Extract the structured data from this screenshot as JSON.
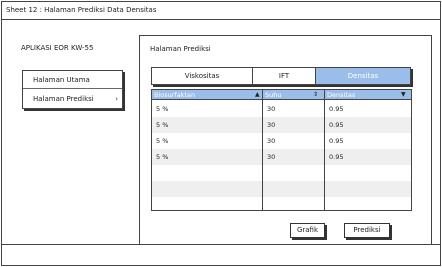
{
  "window": {
    "title": "Sheet 12 : Halaman Prediksi Data Densitas"
  },
  "app": {
    "title": "APLIKASI EOR KW-55"
  },
  "nav": {
    "items": [
      {
        "label": "Halaman Utama"
      },
      {
        "label": "Halaman Prediksi",
        "chevron": "›"
      }
    ]
  },
  "panel": {
    "title": "Halaman Prediksi"
  },
  "tabs": [
    {
      "label": "Viskositas",
      "active": false
    },
    {
      "label": "IFT",
      "active": false
    },
    {
      "label": "Densitas",
      "active": true
    }
  ],
  "table": {
    "columns": [
      {
        "label": "Biosurfaktan",
        "sort_icon": "▲"
      },
      {
        "label": "Suhu",
        "sort_icon": "⇕"
      },
      {
        "label": "Densitas",
        "sort_icon": "▼"
      }
    ],
    "rows": [
      [
        "5 %",
        "30",
        "0.95"
      ],
      [
        "5 %",
        "30",
        "0.95"
      ],
      [
        "5 %",
        "30",
        "0.95"
      ],
      [
        "5 %",
        "30",
        "0.95"
      ],
      [
        "",
        "",
        ""
      ],
      [
        "",
        "",
        ""
      ]
    ]
  },
  "buttons": {
    "grafik": "Grafik",
    "prediksi": "Prediksi"
  },
  "colors": {
    "header_accent": "#9bbde9",
    "alt_row": "#efefef"
  }
}
